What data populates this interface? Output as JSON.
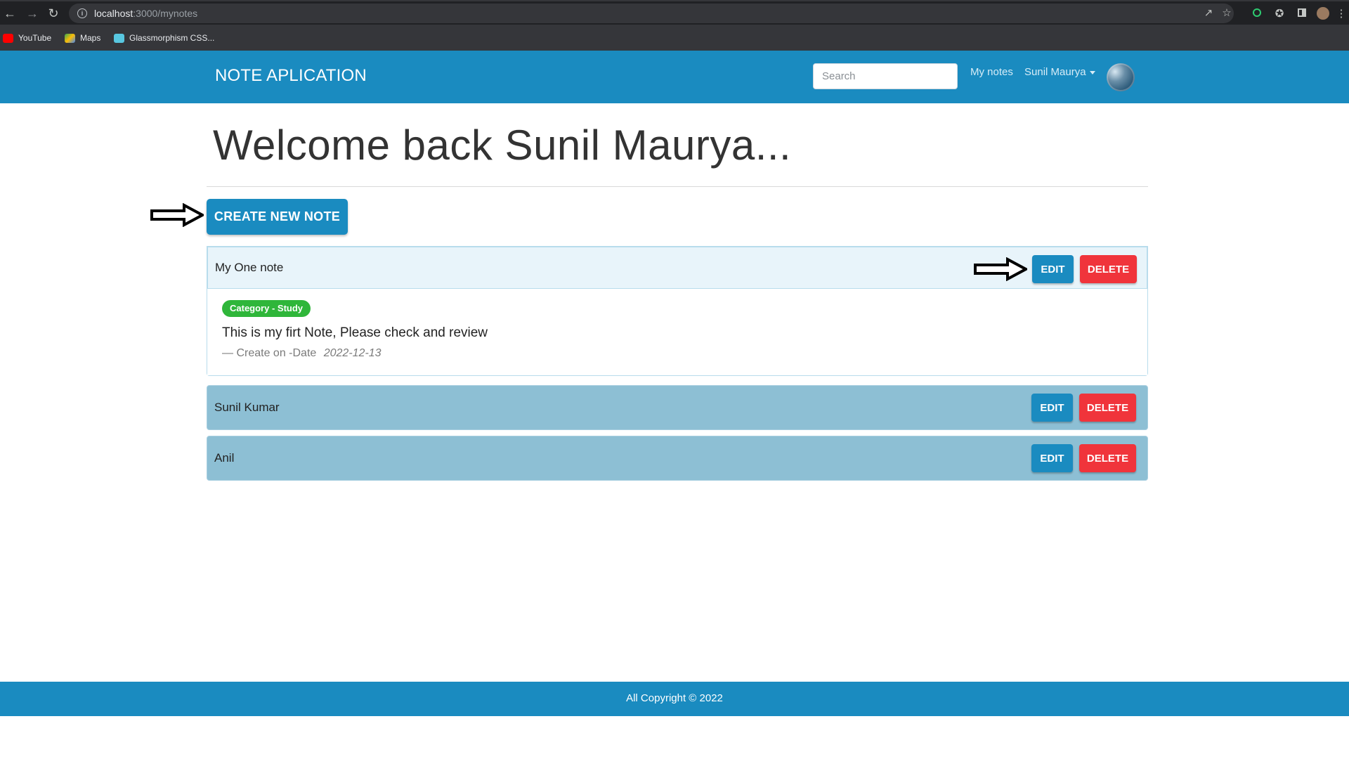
{
  "browser": {
    "url_host": "localhost",
    "url_path": ":3000/mynotes",
    "bookmarks": [
      "YouTube",
      "Maps",
      "Glassmorphism CSS..."
    ]
  },
  "navbar": {
    "brand": "NOTE APLICATION",
    "search_placeholder": "Search",
    "my_notes": "My notes",
    "user_name": "Sunil Maurya"
  },
  "main": {
    "welcome": "Welcome back Sunil Maurya...",
    "create_button": "CREATE NEW NOTE",
    "notes": [
      {
        "title": "My One note",
        "expanded": true,
        "category": "Category - Study",
        "content": "This is my firt Note, Please check and review",
        "date_prefix": "— Create on -Date",
        "date": "2022-12-13",
        "edit_label": "EDIT",
        "delete_label": "DELETE"
      },
      {
        "title": "Sunil Kumar",
        "expanded": false,
        "edit_label": "EDIT",
        "delete_label": "DELETE"
      },
      {
        "title": "Anil",
        "expanded": false,
        "edit_label": "EDIT",
        "delete_label": "DELETE"
      }
    ]
  },
  "footer": {
    "text": "All Copyright © 2022"
  },
  "colors": {
    "primary": "#1a8bc0",
    "danger": "#f0343b",
    "success": "#2fb63a",
    "header_active_bg": "#e8f4fa",
    "header_collapsed_bg": "#8dbfd4"
  }
}
